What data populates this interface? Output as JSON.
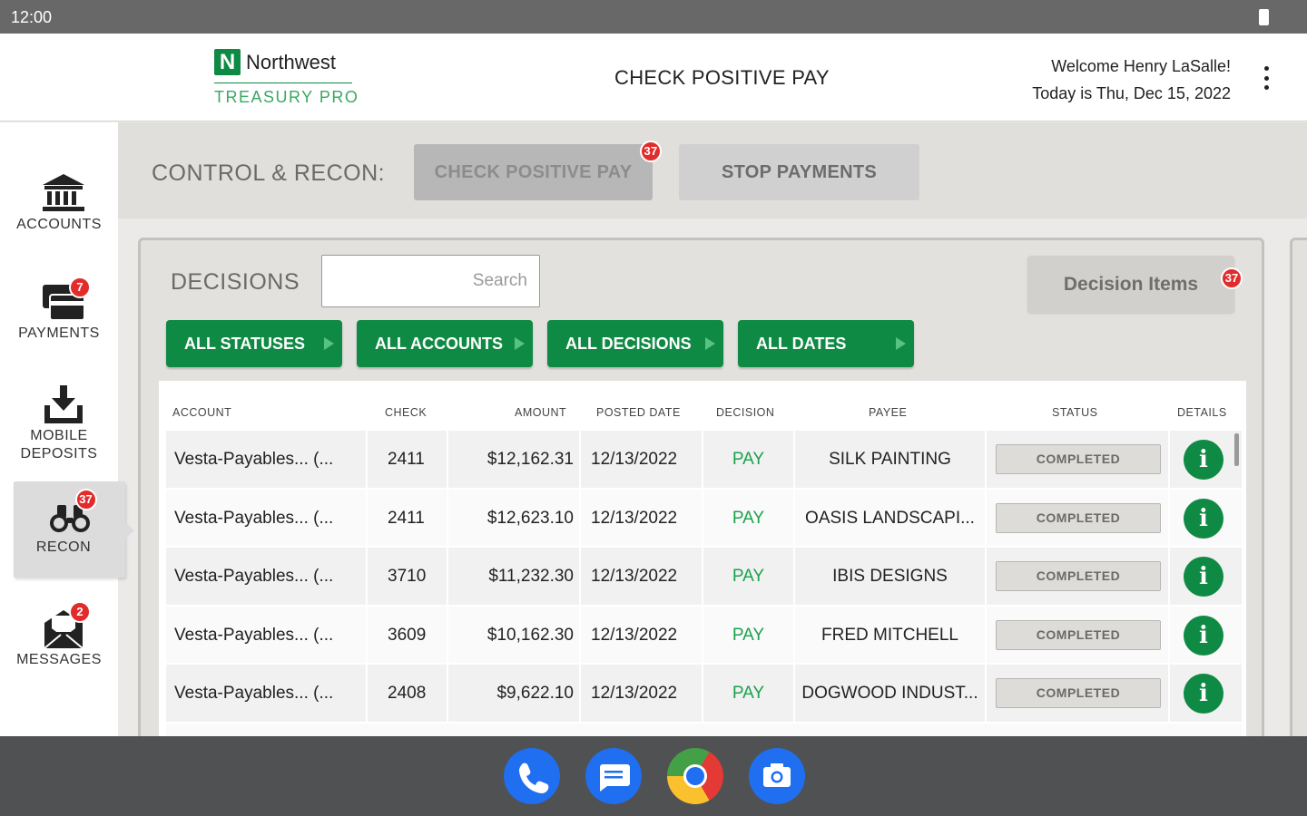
{
  "status_bar": {
    "time": "12:00"
  },
  "header": {
    "logo_mark": "N",
    "brand": "Northwest",
    "brand_sub": "TREASURY PRO",
    "title": "CHECK POSITIVE PAY",
    "welcome": "Welcome Henry LaSalle!",
    "date_line": "Today is Thu, Dec 15, 2022",
    "menu_icon": "more-vert-icon"
  },
  "sidebar": {
    "items": [
      {
        "label": "ACCOUNTS",
        "icon": "bank-icon",
        "badge": ""
      },
      {
        "label": "PAYMENTS",
        "icon": "cards-icon",
        "badge": "7"
      },
      {
        "label": "MOBILE DEPOSITS",
        "icon": "deposit-download-icon",
        "badge": ""
      },
      {
        "label": "RECON",
        "icon": "binoculars-icon",
        "badge": "37",
        "active": true
      },
      {
        "label": "MESSAGES",
        "icon": "envelope-icon",
        "badge": "2"
      }
    ]
  },
  "control": {
    "label": "CONTROL & RECON:",
    "tabs": [
      {
        "label": "CHECK POSITIVE PAY",
        "badge": "37",
        "selected": true
      },
      {
        "label": "STOP PAYMENTS",
        "selected": false
      }
    ]
  },
  "decisions": {
    "title": "DECISIONS",
    "search_placeholder": "Search",
    "decision_items_label": "Decision Items",
    "decision_items_badge": "37",
    "filters": [
      "ALL STATUSES",
      "ALL ACCOUNTS",
      "ALL DECISIONS",
      "ALL DATES"
    ],
    "columns": [
      "ACCOUNT",
      "CHECK",
      "AMOUNT",
      "POSTED DATE",
      "DECISION",
      "PAYEE",
      "STATUS",
      "DETAILS"
    ],
    "rows": [
      {
        "account": "Vesta-Payables... (...",
        "check": "2411",
        "amount": "$12,162.31",
        "posted_date": "12/13/2022",
        "decision": "PAY",
        "payee": "SILK PAINTING",
        "status": "COMPLETED",
        "details_icon": "info-icon"
      },
      {
        "account": "Vesta-Payables... (...",
        "check": "2411",
        "amount": "$12,623.10",
        "posted_date": "12/13/2022",
        "decision": "PAY",
        "payee": "OASIS LANDSCAPI...",
        "status": "COMPLETED",
        "details_icon": "info-icon"
      },
      {
        "account": "Vesta-Payables... (...",
        "check": "3710",
        "amount": "$11,232.30",
        "posted_date": "12/13/2022",
        "decision": "PAY",
        "payee": "IBIS DESIGNS",
        "status": "COMPLETED",
        "details_icon": "info-icon"
      },
      {
        "account": "Vesta-Payables... (...",
        "check": "3609",
        "amount": "$10,162.30",
        "posted_date": "12/13/2022",
        "decision": "PAY",
        "payee": "FRED MITCHELL",
        "status": "COMPLETED",
        "details_icon": "info-icon"
      },
      {
        "account": "Vesta-Payables... (...",
        "check": "2408",
        "amount": "$9,622.10",
        "posted_date": "12/13/2022",
        "decision": "PAY",
        "payee": "DOGWOOD INDUST...",
        "status": "COMPLETED",
        "details_icon": "info-icon"
      }
    ]
  },
  "dock": {
    "apps": [
      "phone-icon",
      "messages-icon",
      "chrome-icon",
      "camera-icon"
    ]
  },
  "colors": {
    "brand_green": "#0f8a44",
    "pay_green": "#1aa24c",
    "badge_red": "#e32b2b"
  }
}
